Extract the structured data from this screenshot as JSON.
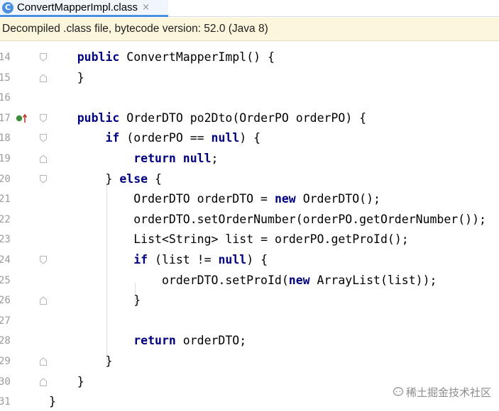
{
  "tab": {
    "icon_letter": "C",
    "title": "ConvertMapperImpl.class",
    "close_glyph": "×"
  },
  "banner": {
    "text": "Decompiled .class file, bytecode version: 52.0 (Java 8)"
  },
  "lines": [
    {
      "num": "14",
      "code": "    public ConvertMapperImpl() {"
    },
    {
      "num": "15",
      "code": "    }"
    },
    {
      "num": "16",
      "code": ""
    },
    {
      "num": "17",
      "code": "    public OrderDTO po2Dto(OrderPO orderPO) {"
    },
    {
      "num": "18",
      "code": "        if (orderPO == null) {"
    },
    {
      "num": "19",
      "code": "            return null;"
    },
    {
      "num": "20",
      "code": "        } else {"
    },
    {
      "num": "21",
      "code": "            OrderDTO orderDTO = new OrderDTO();"
    },
    {
      "num": "22",
      "code": "            orderDTO.setOrderNumber(orderPO.getOrderNumber());"
    },
    {
      "num": "23",
      "code": "            List<String> list = orderPO.getProId();"
    },
    {
      "num": "24",
      "code": "            if (list != null) {"
    },
    {
      "num": "25",
      "code": "                orderDTO.setProId(new ArrayList(list));"
    },
    {
      "num": "26",
      "code": "            }"
    },
    {
      "num": "27",
      "code": ""
    },
    {
      "num": "28",
      "code": "            return orderDTO;"
    },
    {
      "num": "29",
      "code": "        }"
    },
    {
      "num": "30",
      "code": "    }"
    },
    {
      "num": "31",
      "code": "}"
    }
  ],
  "keywords": [
    "public",
    "if",
    "null",
    "return",
    "else",
    "new"
  ],
  "colors": {
    "keyword": "#000080",
    "tab_accent": "#4a8fe0",
    "banner_bg": "#fcf6dc",
    "line_number": "#9b9b9b",
    "run_marker": "#3d8f3d",
    "override_arrow": "#c0392b"
  },
  "gutter_icons": {
    "line_17": "implements-method-icon"
  },
  "watermark": {
    "text": "稀土掘金技术社区"
  }
}
